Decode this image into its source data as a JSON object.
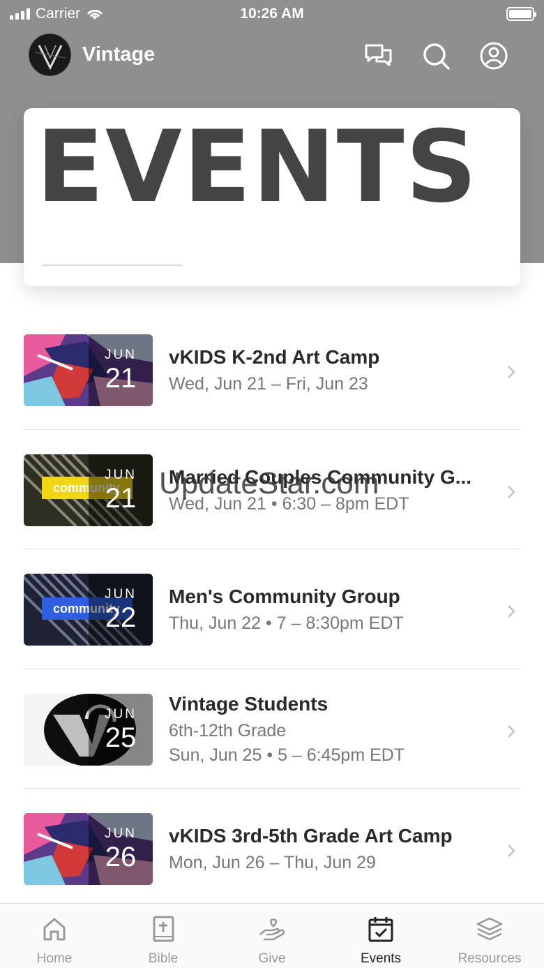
{
  "status_bar": {
    "carrier": "Carrier",
    "time": "10:26 AM"
  },
  "nav": {
    "title": "Vintage",
    "icons": [
      "chat-icon",
      "search-icon",
      "account-icon"
    ]
  },
  "hero": {
    "title": "EVENTS"
  },
  "events": [
    {
      "title": "vKIDS K-2nd Art Camp",
      "lines": [
        "Wed, Jun 21 – Fri, Jun 23"
      ],
      "month": "JUN",
      "day": "21",
      "thumb": "art"
    },
    {
      "title": "Married Couples Community G...",
      "lines": [
        "Wed, Jun 21 • 6:30 – 8pm EDT"
      ],
      "month": "JUN",
      "day": "21",
      "thumb": "community-yellow"
    },
    {
      "title": "Men's Community Group",
      "lines": [
        "Thu, Jun 22 • 7 – 8:30pm EDT"
      ],
      "month": "JUN",
      "day": "22",
      "thumb": "community-blue"
    },
    {
      "title": "Vintage Students",
      "lines": [
        "6th-12th Grade",
        "Sun, Jun 25 • 5 – 6:45pm EDT"
      ],
      "month": "JUN",
      "day": "25",
      "thumb": "students"
    },
    {
      "title": "vKIDS 3rd-5th Grade Art Camp",
      "lines": [
        "Mon, Jun 26 – Thu, Jun 29"
      ],
      "month": "JUN",
      "day": "26",
      "thumb": "art"
    }
  ],
  "watermark": "UpdateStar.com",
  "tabs": [
    {
      "label": "Home",
      "icon": "home-icon",
      "active": false
    },
    {
      "label": "Bible",
      "icon": "bible-icon",
      "active": false
    },
    {
      "label": "Give",
      "icon": "give-icon",
      "active": false
    },
    {
      "label": "Events",
      "icon": "calendar-icon",
      "active": true
    },
    {
      "label": "Resources",
      "icon": "layers-icon",
      "active": false
    }
  ],
  "colors": {
    "header_bg": "#8f8f8f",
    "hero_text": "#444444",
    "active_tab": "#222222",
    "inactive_tab": "#999999"
  }
}
